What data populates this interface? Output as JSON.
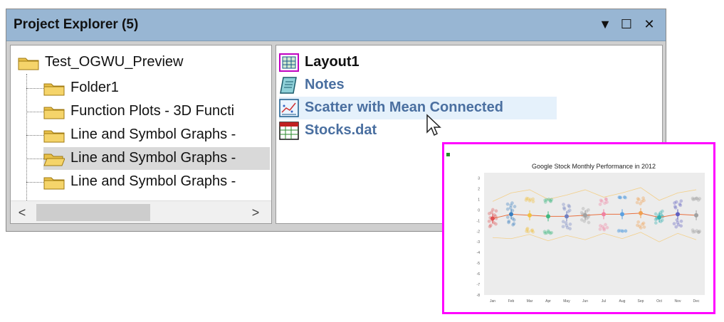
{
  "panel": {
    "title": "Project Explorer (5)",
    "buttons": [
      "▼",
      "☐",
      "✕"
    ]
  },
  "tree": {
    "root": "Test_OGWU_Preview",
    "children": [
      {
        "label": "Folder1",
        "open": false,
        "selected": false
      },
      {
        "label": "Function Plots - 3D Functi",
        "open": false,
        "selected": false
      },
      {
        "label": "Line and Symbol Graphs -",
        "open": false,
        "selected": false
      },
      {
        "label": "Line and Symbol Graphs -",
        "open": true,
        "selected": true
      },
      {
        "label": "Line and Symbol Graphs -",
        "open": false,
        "selected": false
      }
    ],
    "scroll_left": "<",
    "scroll_right": ">"
  },
  "list": {
    "items": [
      {
        "label": "Layout1",
        "icon": "layout-icon",
        "color": "#111111"
      },
      {
        "label": "Notes",
        "icon": "notes-icon",
        "color": "#4a6fa0"
      },
      {
        "label": "Scatter with Mean Connected",
        "icon": "graph-icon",
        "color": "#4a6fa0"
      },
      {
        "label": "Stocks.dat",
        "icon": "workbook-icon",
        "color": "#4a6fa0"
      }
    ]
  },
  "preview": {
    "chart_data": {
      "type": "scatter",
      "title": "Google Stock Monthly Performance in 2012",
      "categories": [
        "Jan",
        "Feb",
        "Mar",
        "Apr",
        "May",
        "Jun",
        "Jul",
        "Aug",
        "Sep",
        "Oct",
        "Nov",
        "Dec"
      ],
      "yticks": [
        "3",
        "2",
        "1",
        "0",
        "-1",
        "-2",
        "-3",
        "-4",
        "-5",
        "-6",
        "-7",
        "-8"
      ],
      "ylim": [
        -8,
        3.5
      ],
      "series": [
        {
          "values": [
            -0.8,
            -0.4,
            -0.5,
            -0.6,
            -0.6,
            -0.5,
            -0.4,
            -0.4,
            -0.3,
            -0.7,
            -0.4,
            -0.5
          ]
        }
      ],
      "colors": [
        "#e05050",
        "#3a7fc0",
        "#f0c040",
        "#40b880",
        "#7080c0",
        "#a0a0a0",
        "#f080a0",
        "#5aa0e0",
        "#f0a050",
        "#30b0b0",
        "#6060c0",
        "#a0a0a0"
      ]
    }
  }
}
